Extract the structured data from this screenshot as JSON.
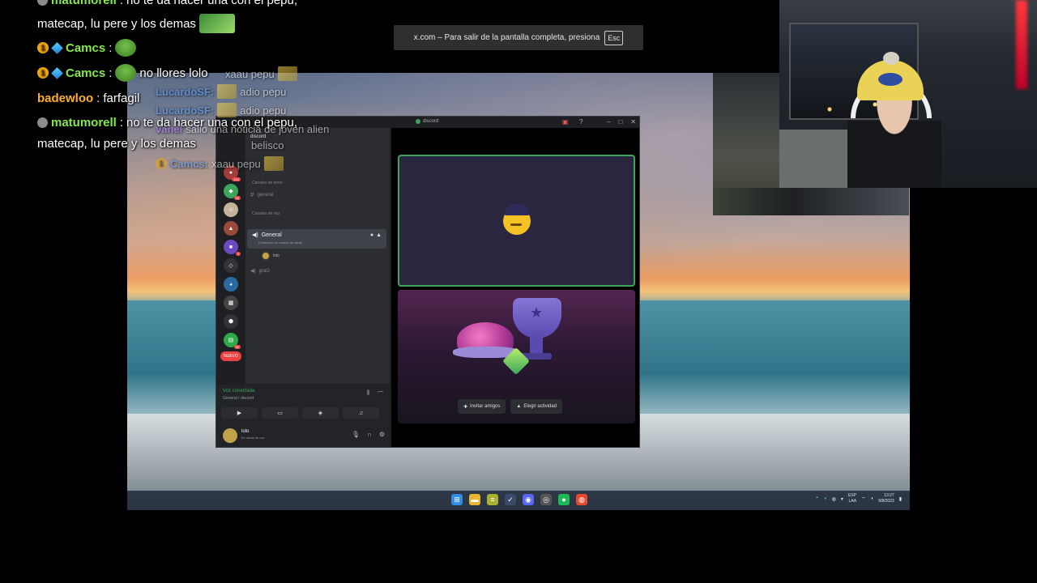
{
  "toast": {
    "text": "x.com – Para salir de la pantalla completa, presiona",
    "key": "Esc"
  },
  "chat": [
    {
      "user": "matumorell",
      "text": "no te da hacer una con el pepu,",
      "color": "green"
    },
    {
      "user": "",
      "text": "matecap, lu pere y los demas",
      "color": ""
    },
    {
      "user": "Camcs",
      "text": "",
      "color": "green"
    },
    {
      "user": "Camcs",
      "text": "no llores lolo",
      "color": "green"
    },
    {
      "user": "badewloo",
      "text": "farfagil",
      "color": "orange"
    },
    {
      "user": "matumorell",
      "text": "no te da hacer una con el pepu,",
      "color": "green"
    },
    {
      "user": "",
      "text": "matecap, lu pere y los demas",
      "color": ""
    }
  ],
  "chat_ghost": [
    {
      "user": "",
      "text": "xaau pepu"
    },
    {
      "user": "LucardoSF:",
      "text": "adio pepu"
    },
    {
      "user": "LucardoSF:",
      "text": "adio pepu"
    },
    {
      "user": "vanel",
      "text": "salio una noticia de joven alien"
    },
    {
      "user": "",
      "text": "belisco"
    },
    {
      "user": "Camcs:",
      "text": "xaau pepu"
    }
  ],
  "discord": {
    "title": "discord",
    "server_name": "discord",
    "text_category": "Canales de texto",
    "text_channel": "general",
    "voice_category": "Canales de voz",
    "voice_channel": "General",
    "voice_sub": "Establecer un estado de canal",
    "member": "lolo",
    "voice_channel2": "gral2",
    "new_badge": "NUEVO",
    "voice_status": "Voz conectada",
    "voice_where": "General / discord",
    "username": "lolo",
    "user_status": "En canal de voz",
    "invite_label": "Invitar amigos",
    "activity_label": "Elegir actividad",
    "badges": [
      "144",
      "28",
      "3",
      "30"
    ]
  },
  "taskbar": {
    "lang": "ESP",
    "lang2": "LAA",
    "time": "13:27",
    "date": "8/8/2023"
  },
  "colors": {
    "accent_green": "#3ba55c",
    "discord_bg": "#1e1f22",
    "chat_green": "#87e84d",
    "chat_orange": "#ffb030"
  }
}
